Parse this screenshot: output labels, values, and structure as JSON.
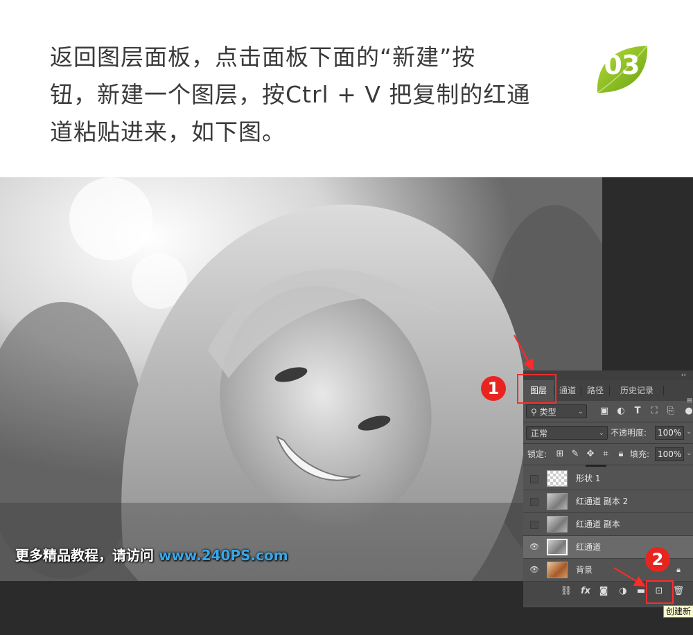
{
  "instruction": {
    "lines": [
      "返回图层面板，点击面板下面的“新建”按",
      "钮，新建一个图层，按Ctrl + V 把复制的红通",
      "道粘贴进来，如下图。"
    ]
  },
  "step_badge": {
    "number": "03",
    "color": "#8cc020"
  },
  "watermark": {
    "prefix": "更多精品教程，请访问",
    "url": "www.240PS.com"
  },
  "panel": {
    "collapse": "‹‹",
    "tabs": [
      {
        "label": "图层",
        "active": true
      },
      {
        "label": "通道",
        "active": false
      },
      {
        "label": "路径",
        "active": false
      },
      {
        "label": "历史记录",
        "active": false
      }
    ],
    "filter": {
      "label": "类型",
      "icons": [
        "image-filter-icon",
        "adjustment-filter-icon",
        "text-filter-icon",
        "shape-filter-icon",
        "smart-object-filter-icon"
      ]
    },
    "blend_mode": "正常",
    "opacity": {
      "label": "不透明度:",
      "value": "100%"
    },
    "lock": {
      "label": "锁定:"
    },
    "fill": {
      "label": "填充:",
      "value": "100%"
    },
    "layers": [
      {
        "name": "形状 1",
        "visible": false,
        "thumb": "checker",
        "selected": false
      },
      {
        "name": "红通道 副本 2",
        "visible": false,
        "thumb": "gray",
        "selected": false
      },
      {
        "name": "红通道 副本",
        "visible": false,
        "thumb": "gray",
        "selected": false
      },
      {
        "name": "红通道",
        "visible": true,
        "thumb": "gray",
        "selected": true
      },
      {
        "name": "背景",
        "visible": true,
        "thumb": "color",
        "selected": false,
        "locked": true
      }
    ],
    "footer_buttons": {
      "fx": "fx"
    },
    "tooltip": "创建新"
  },
  "markers": [
    {
      "label": "1",
      "color": "#e8241f"
    },
    {
      "label": "2",
      "color": "#e8241f"
    }
  ],
  "highlight_color": "#ff2a2a"
}
